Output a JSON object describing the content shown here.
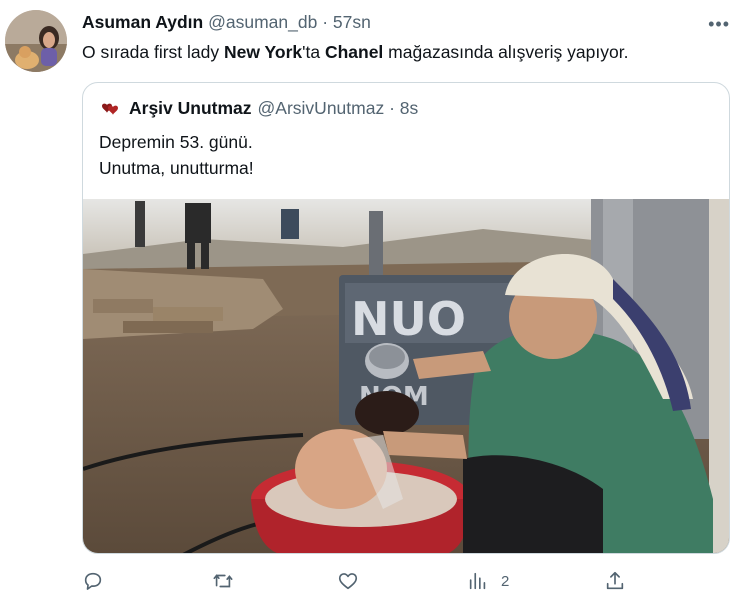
{
  "tweet": {
    "author_name": "Asuman Aydın",
    "author_handle": "@asuman_db",
    "separator": "·",
    "time": "57sn",
    "more": "•••",
    "text_parts": [
      "O sırada first lady ",
      "New York",
      "'ta ",
      "Chanel",
      " mağazasında alışveriş yapıyor."
    ]
  },
  "quote": {
    "author_name": "Arşiv Unutmaz",
    "author_handle": "@ArsivUnutmaz",
    "separator": "·",
    "time": "8s",
    "lines": [
      "Depremin 53. günü.",
      "Unutma, unutturma!"
    ],
    "image": {
      "sign_text_1": "NUO",
      "sign_text_2": "NOM"
    }
  },
  "actions": [
    {
      "name": "reply",
      "icon": "reply-icon",
      "count": ""
    },
    {
      "name": "retweet",
      "icon": "retweet-icon",
      "count": ""
    },
    {
      "name": "like",
      "icon": "heart-icon",
      "count": ""
    },
    {
      "name": "views",
      "icon": "views-chart-icon",
      "count": "2"
    },
    {
      "name": "share",
      "icon": "share-icon",
      "count": ""
    }
  ],
  "colors": {
    "text": "#0f1419",
    "secondary": "#536471",
    "border": "#cfd9de"
  }
}
